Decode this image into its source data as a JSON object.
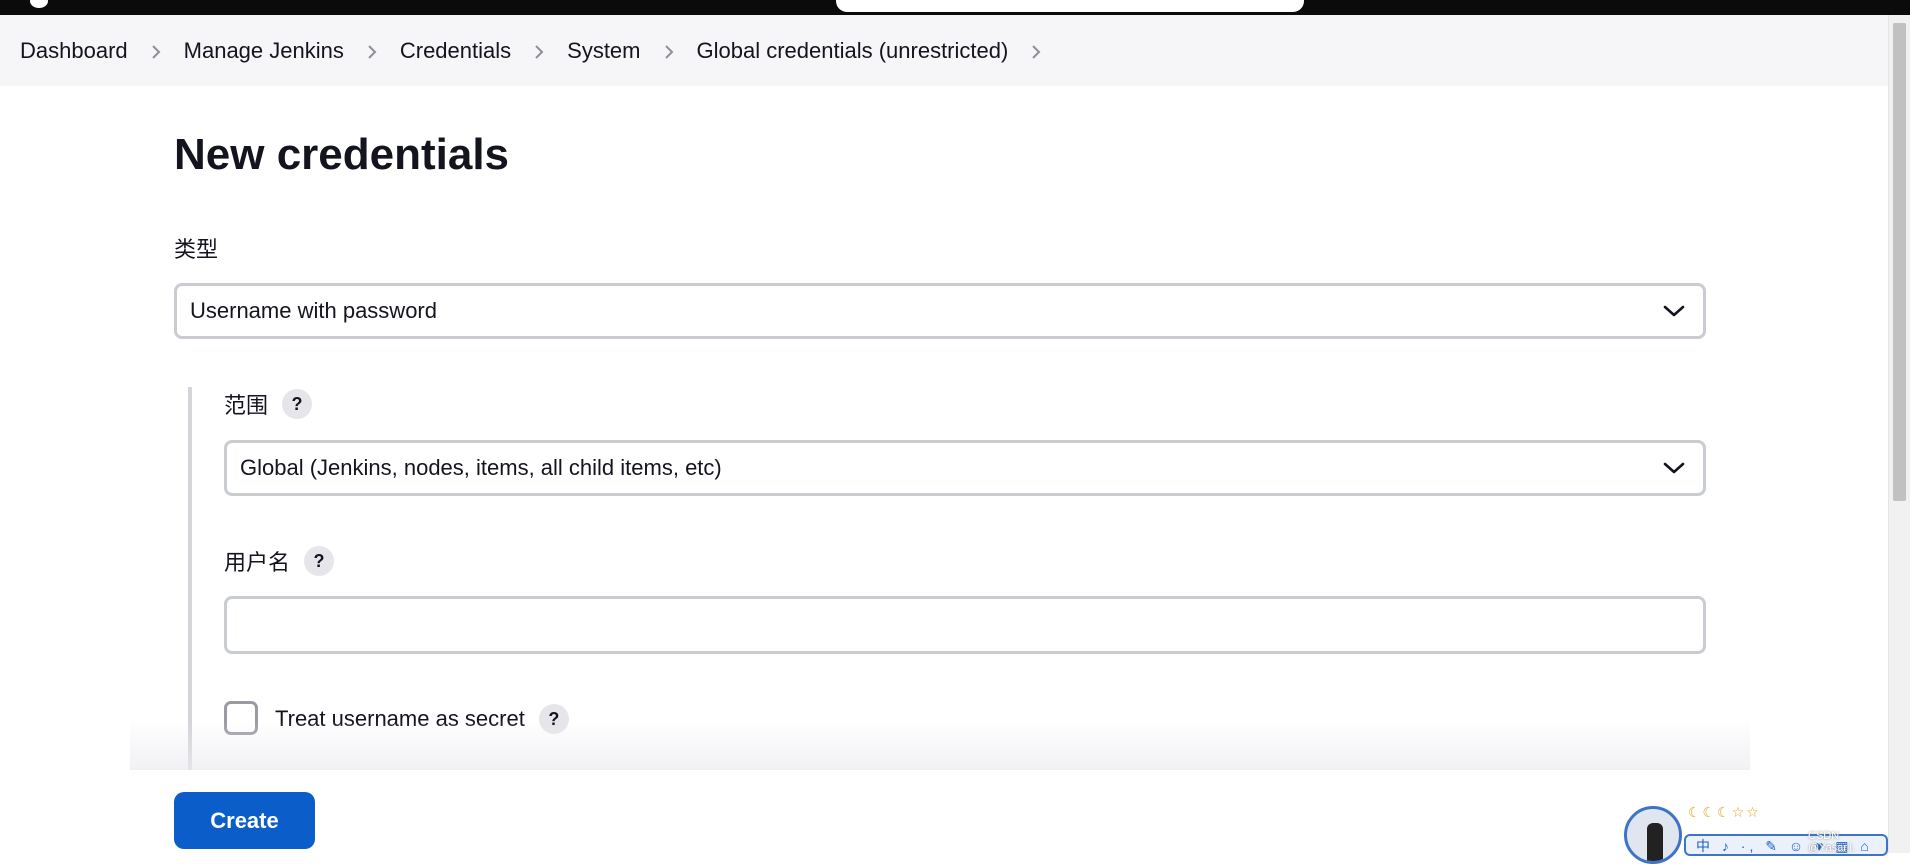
{
  "breadcrumb": {
    "items": [
      "Dashboard",
      "Manage Jenkins",
      "Credentials",
      "System",
      "Global credentials (unrestricted)"
    ]
  },
  "page": {
    "title": "New credentials"
  },
  "form": {
    "kind": {
      "label": "类型",
      "value": "Username with password"
    },
    "scope": {
      "label": "范围",
      "value": "Global (Jenkins, nodes, items, all child items, etc)"
    },
    "username": {
      "label": "用户名",
      "value": ""
    },
    "username_secret": {
      "label": "Treat username as secret",
      "checked": false
    },
    "help_symbol": "?",
    "create_label": "Create"
  },
  "widget": {
    "moons": "☾☾☾☆☆",
    "strip_text": "中 ♪ ·, ✎ ☺ ♥ ▦ ⌂",
    "watermark": "CSDN @Yasar.l."
  },
  "icons": {
    "breadcrumb_separator": "chevron-right-icon",
    "select_arrow": "chevron-down-icon",
    "help": "question-mark-icon"
  },
  "colors": {
    "primary_button": "#0b5ec9",
    "breadcrumb_bg": "#f6f6f8",
    "input_border": "#c9ccd1"
  }
}
